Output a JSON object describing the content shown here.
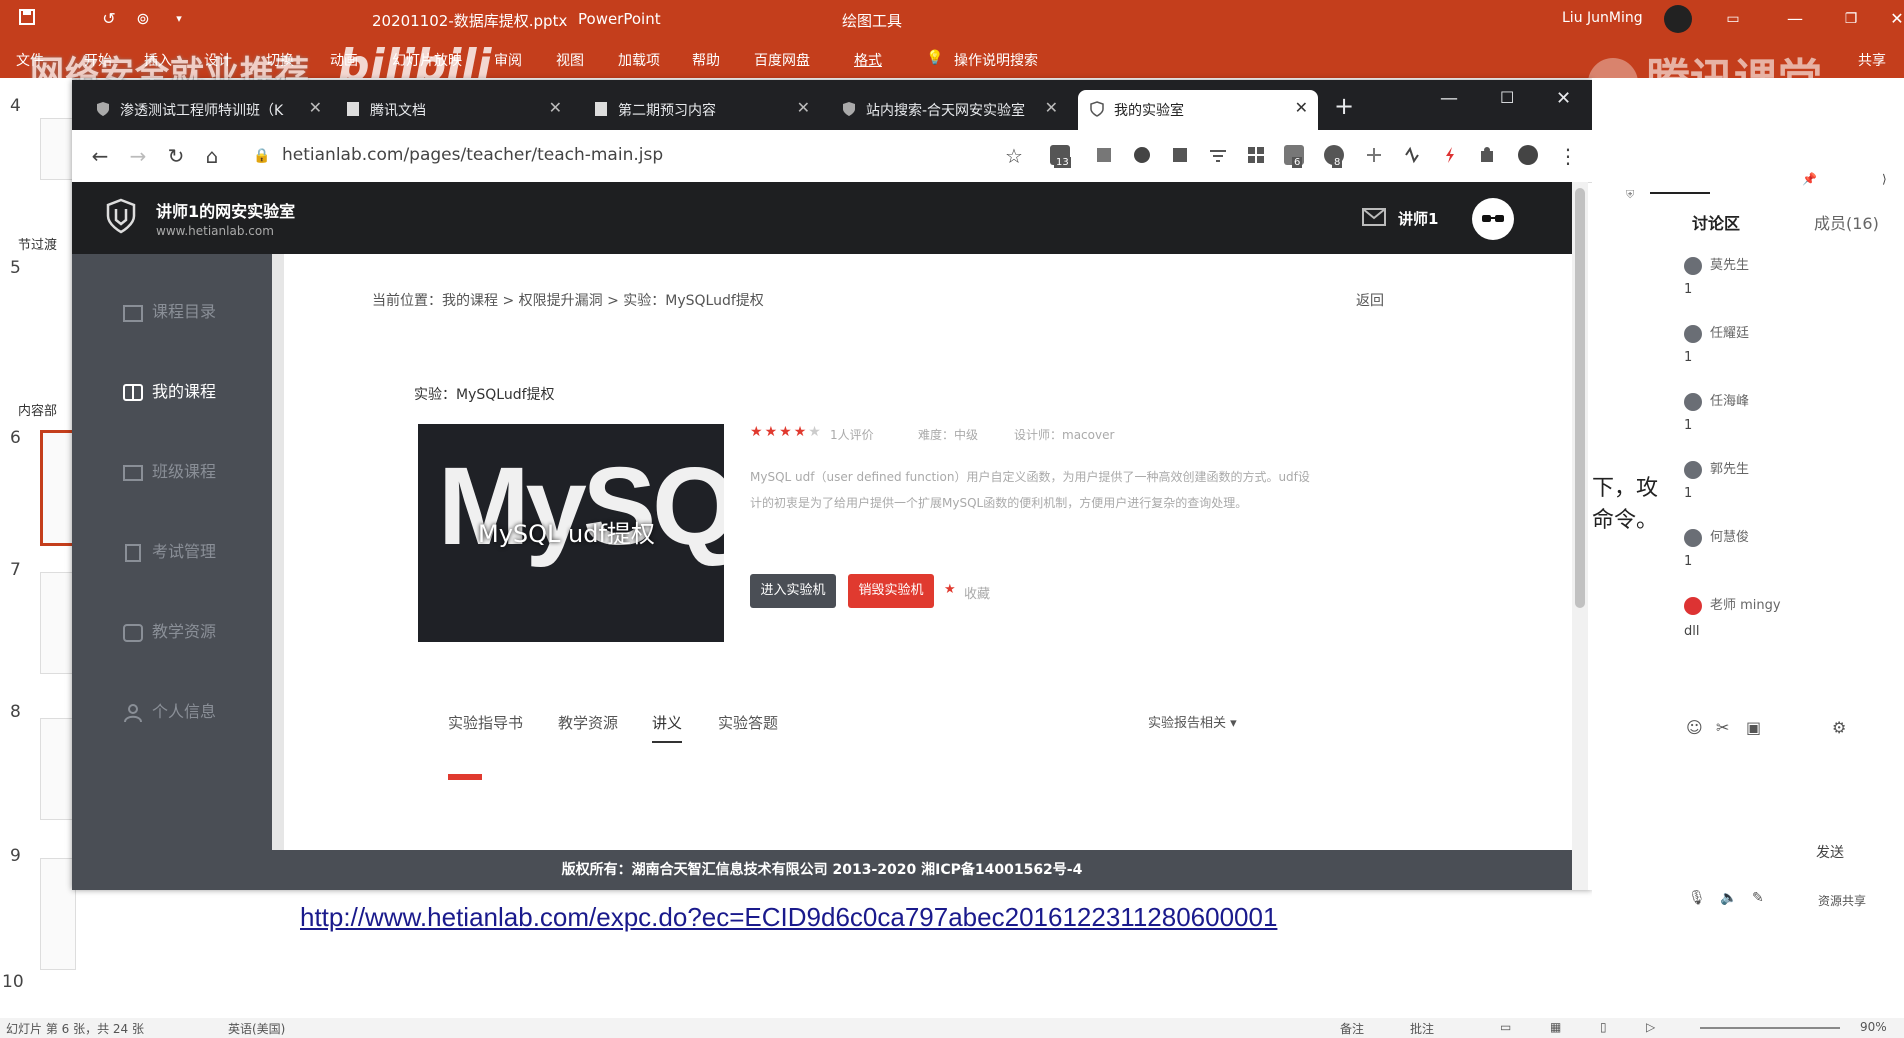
{
  "ppt": {
    "title": "20201102-数据库提权.pptx",
    "app_name": "PowerPoint",
    "tools_label": "绘图工具",
    "user_name": "Liu JunMing",
    "ribbon_tabs": [
      "文件",
      "开始",
      "插入",
      "设计",
      "切换",
      "动画",
      "幻灯片放映",
      "审阅",
      "视图",
      "加载项",
      "帮助",
      "百度网盘",
      "格式"
    ],
    "tell_me": "操作说明搜索",
    "share": "共享",
    "slide_numbers": [
      "4",
      "5",
      "6",
      "7",
      "8",
      "9",
      "10"
    ],
    "section_labels": [
      "节过渡",
      "内容部"
    ],
    "status": {
      "slide_info": "幻灯片 第 6 张，共 24 张",
      "language": "英语(美国)",
      "notes": "备注",
      "comments": "批注",
      "zoom": "90%"
    },
    "slide_link": "http://www.hetianlab.com/expc.do?ec=ECID9d6c0ca797abec2016122311280600001"
  },
  "overlays": {
    "left_text": "网络安全就业推荐",
    "bili": "bilibili",
    "tencent": "腾讯课堂"
  },
  "browser": {
    "tabs": [
      {
        "label": "渗透测试工程师特训班（K",
        "active": false
      },
      {
        "label": "腾讯文档",
        "active": false
      },
      {
        "label": "第二期预习内容",
        "active": false
      },
      {
        "label": "站内搜索-合天网安实验室",
        "active": false
      },
      {
        "label": "我的实验室",
        "active": true
      }
    ],
    "url": "hetianlab.com/pages/teacher/teach-main.jsp",
    "ext_badges": [
      "13",
      "6",
      "8"
    ]
  },
  "site": {
    "name": "讲师1的网安实验室",
    "domain": "www.hetianlab.com",
    "user": "讲师1",
    "sidebar": [
      "课程目录",
      "我的课程",
      "班级课程",
      "考试管理",
      "教学资源",
      "个人信息"
    ],
    "breadcrumb": "当前位置：我的课程 > 权限提升漏洞 > 实验：MySQLudf提权",
    "back": "返回",
    "exp_title": "实验：MySQLudf提权",
    "image_big": "MySQL",
    "image_overlay": "MySQL udf提权",
    "rating_count": "1人评价",
    "difficulty": "难度：中级",
    "designer": "设计师：macover",
    "description": "MySQL udf（user defined function）用户自定义函数，为用户提供了一种高效创建函数的方式。udf设计的初衷是为了给用户提供一个扩展MySQL函数的便利机制，方便用户进行复杂的查询处理。",
    "btn_enter": "进入实验机",
    "btn_destroy": "销毁实验机",
    "favorite": "收藏",
    "content_tabs": [
      "实验指导书",
      "教学资源",
      "讲义",
      "实验答题"
    ],
    "report_label": "实验报告相关",
    "footer": "版权所有：湖南合天智汇信息技术有限公司 2013-2020 湘ICP备14001562号-4",
    "rating": 4,
    "rating_max": 5
  },
  "panel": {
    "discussion_tab": "讨论区",
    "members_tab": "成员(16)",
    "members": [
      {
        "name": "莫先生",
        "msg": "1"
      },
      {
        "name": "任耀廷",
        "msg": "1"
      },
      {
        "name": "任海峰",
        "msg": "1"
      },
      {
        "name": "郭先生",
        "msg": "1"
      },
      {
        "name": "何慧俊",
        "msg": "1"
      },
      {
        "name": "老师 mingy",
        "msg": "dll"
      }
    ],
    "side_text_1": "下，攻",
    "side_text_2": "命令。",
    "send_label": "发送",
    "bottom_label": "资源共享",
    "colors": {
      "accent": "#c43e1c",
      "red": "#e03a2f"
    }
  }
}
